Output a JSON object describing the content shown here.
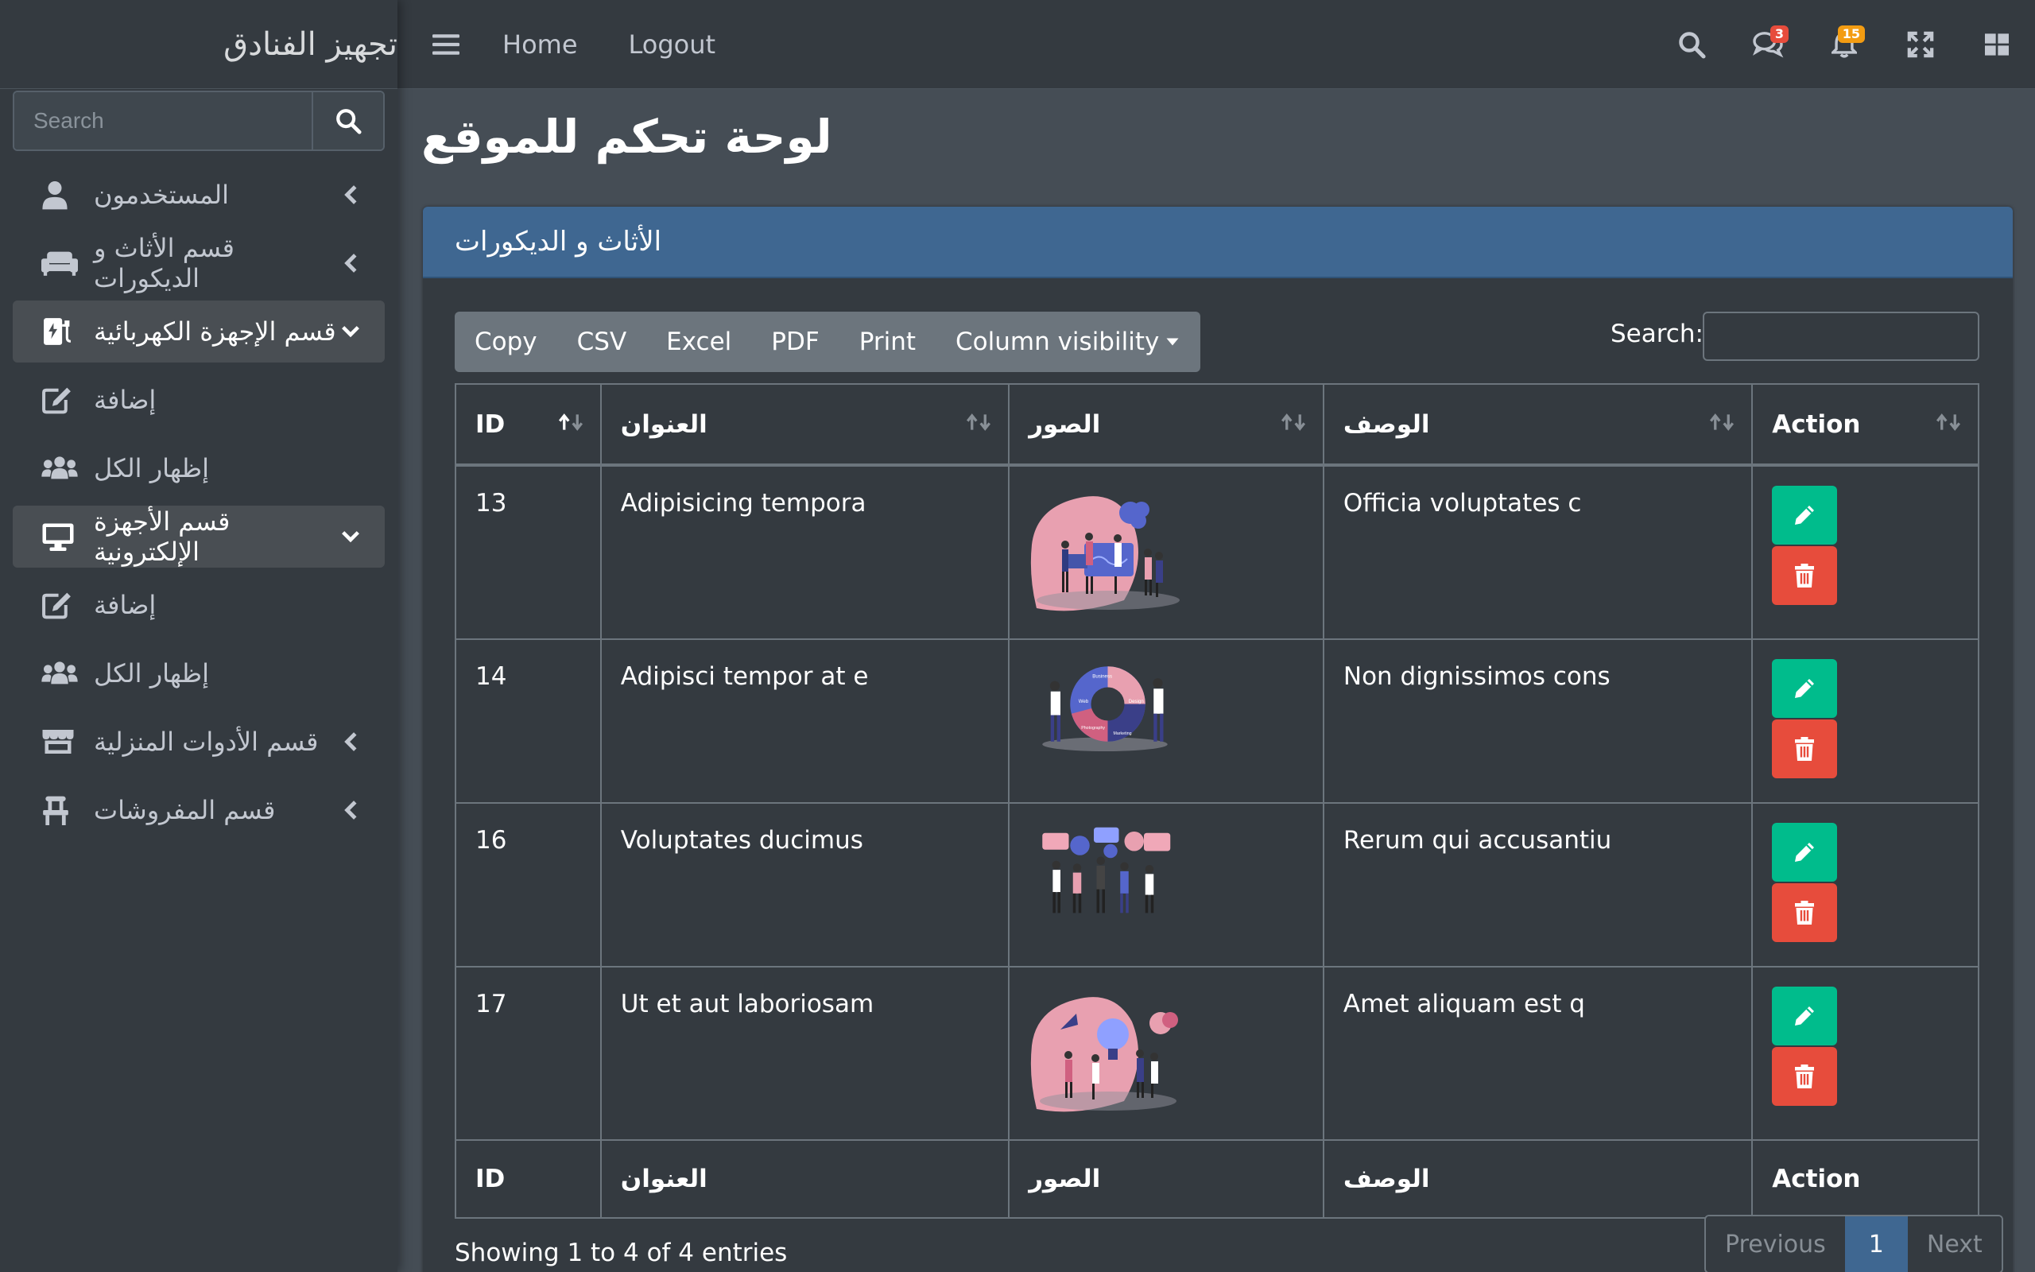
{
  "brand": "تجهيز الفنادق",
  "sidebar_search": {
    "placeholder": "Search"
  },
  "nav": [
    {
      "label": "المستخدمون",
      "icon": "user-icon",
      "open": false
    },
    {
      "label": "قسم الأثاث و الديكورات",
      "icon": "couch-icon",
      "open": false
    },
    {
      "label": "قسم الإجهزة الكهربائية",
      "icon": "charging-station-icon",
      "open": true
    },
    {
      "label": "إضافة",
      "icon": "edit-icon",
      "open": false
    },
    {
      "label": "إظهار الكل",
      "icon": "users-icon",
      "open": false
    },
    {
      "label": "قسم الأجهزة الإلكترونية",
      "icon": "desktop-icon",
      "open": true
    },
    {
      "label": "إضافة",
      "icon": "edit-icon",
      "open": false
    },
    {
      "label": "إظهار الكل",
      "icon": "users-icon",
      "open": false
    },
    {
      "label": "قسم الأدوات المنزلية",
      "icon": "store-icon",
      "open": false
    },
    {
      "label": "قسم المفروشات",
      "icon": "chair-icon",
      "open": false
    }
  ],
  "topbar": {
    "home": "Home",
    "logout": "Logout",
    "messages_count": "3",
    "notifications_count": "15"
  },
  "page_title": "لوحة تحكم للموقع",
  "card_title": "الأثاث و الديكورات",
  "toolbar": {
    "copy": "Copy",
    "csv": "CSV",
    "excel": "Excel",
    "pdf": "PDF",
    "print": "Print",
    "column_visibility": "Column visibility"
  },
  "search_label": "Search:",
  "table": {
    "headers": [
      "ID",
      "العنوان",
      "الصور",
      "الوصف",
      "Action"
    ],
    "rows": [
      {
        "id": "13",
        "title": "Adipisicing tempora",
        "image": "team-puzzle-illustration",
        "desc": "Officia voluptates c"
      },
      {
        "id": "14",
        "title": "Adipisci tempor at e",
        "image": "business-wheel-illustration",
        "desc": "Non dignissimos cons"
      },
      {
        "id": "16",
        "title": "Voluptates ducimus",
        "image": "speech-bubbles-illustration",
        "desc": "Rerum qui accusantiu"
      },
      {
        "id": "17",
        "title": "Ut et aut laboriosam",
        "image": "idea-bulb-illustration",
        "desc": "Amet aliquam est q"
      }
    ],
    "wheel_labels": [
      "Business",
      "Web",
      "Design",
      "Photography",
      "Marketing"
    ]
  },
  "info": "Showing 1 to 4 of 4 entries",
  "pagination": {
    "previous": "Previous",
    "current": "1",
    "next": "Next"
  }
}
